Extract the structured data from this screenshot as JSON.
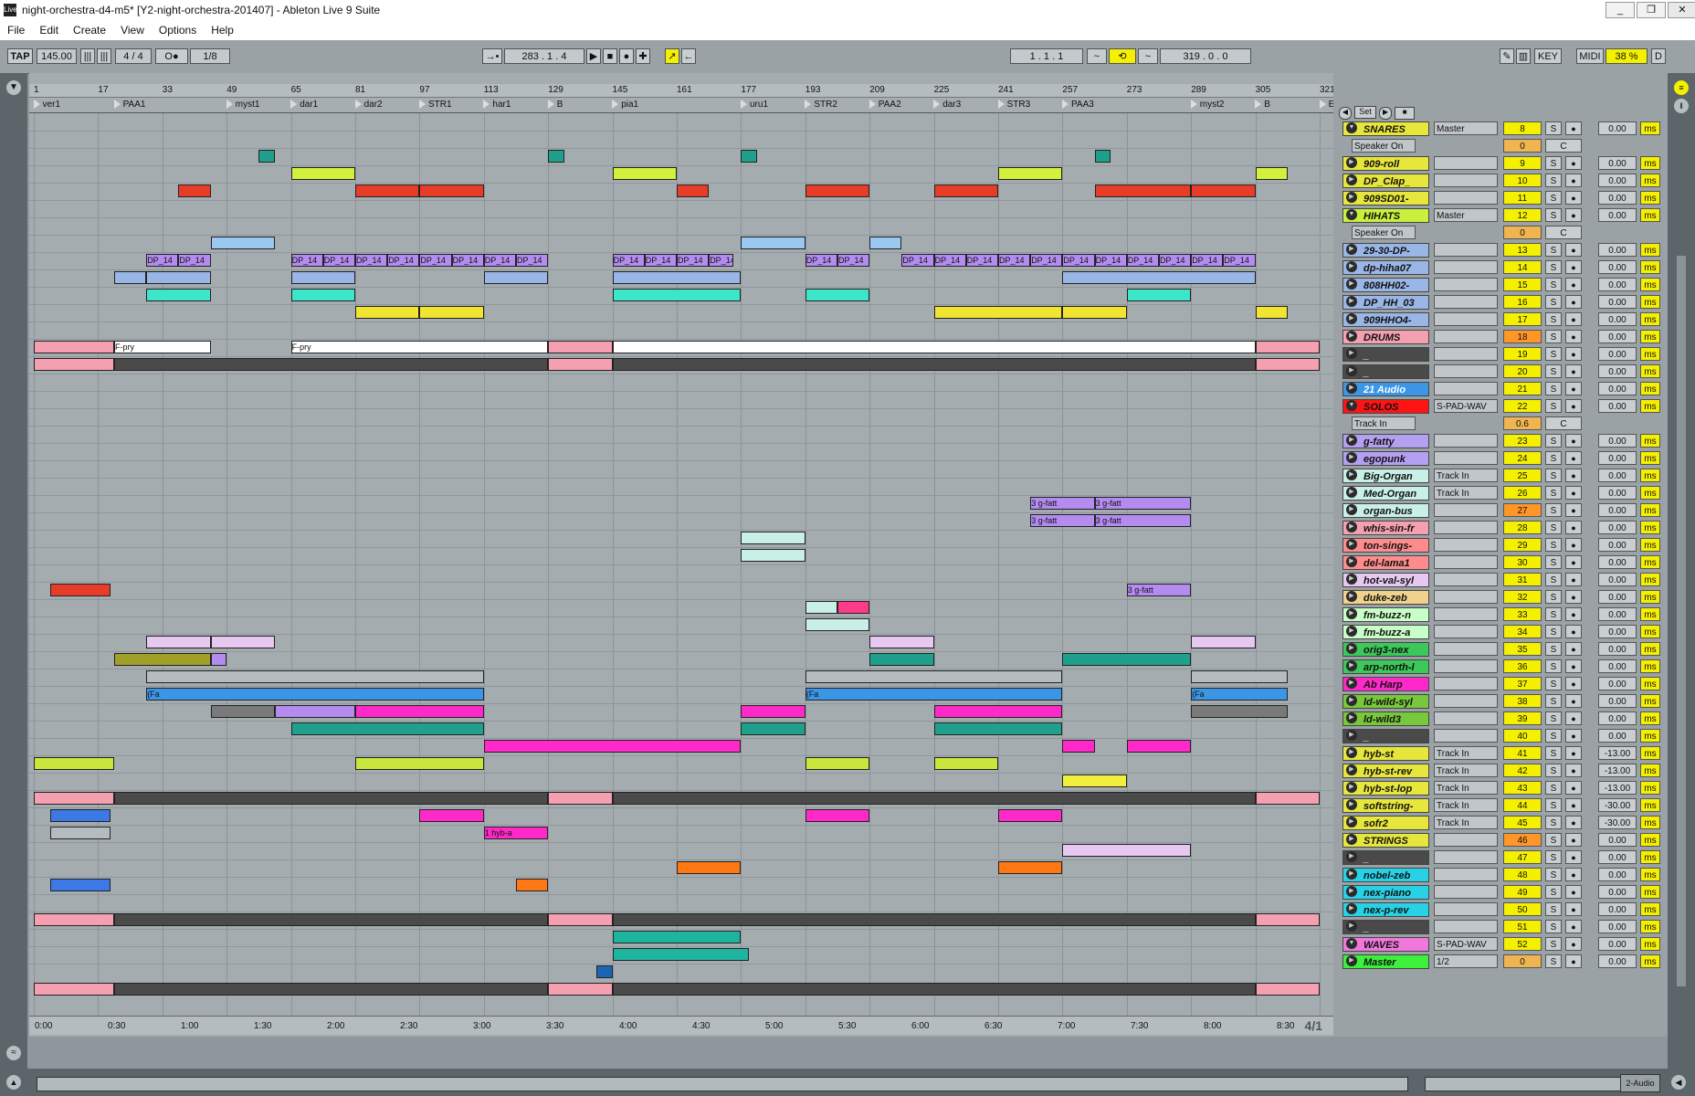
{
  "window": {
    "title": "night-orchestra-d4-m5*  [Y2-night-orchestra-201407] - Ableton Live 9 Suite",
    "logo_text": "Live",
    "controls": [
      "_",
      "❐",
      "✕"
    ]
  },
  "menu": [
    "File",
    "Edit",
    "Create",
    "View",
    "Options",
    "Help"
  ],
  "transport": {
    "tap": "TAP",
    "tempo": "145.00",
    "nudge": [
      "|||",
      "|||"
    ],
    "signature": "4 / 4",
    "metronome": "O●",
    "quantize": "1/8",
    "follow": "→•",
    "position": "283 .   1 .   4",
    "play": "▶",
    "stop": "■",
    "record": "●",
    "add": "✚",
    "draw": "↗",
    "back": "←",
    "loop_start": "1 .   1 .   1",
    "loop_length": "319 .   0 .   0",
    "pencil": "✎",
    "key": "KEY",
    "midi": "MIDI",
    "cpu": "38 %",
    "d": "D"
  },
  "ruler": [
    "1",
    "17",
    "33",
    "49",
    "65",
    "81",
    "97",
    "113",
    "129",
    "145",
    "161",
    "177",
    "193",
    "209",
    "225",
    "241",
    "257",
    "273",
    "289",
    "305",
    "321"
  ],
  "locators": [
    "ver1",
    "PAA1",
    "myst1",
    "dar1",
    "dar2",
    "STR1",
    "har1",
    "B",
    "pia1",
    "uru1",
    "STR2",
    "PAA2",
    "dar3",
    "STR3",
    "PAA3",
    "myst2",
    "B",
    "END"
  ],
  "time_ruler": [
    "0:00",
    "0:30",
    "1:00",
    "1:30",
    "2:00",
    "2:30",
    "3:00",
    "3:30",
    "4:00",
    "4:30",
    "5:00",
    "5:30",
    "6:00",
    "6:30",
    "7:00",
    "7:30",
    "8:00",
    "8:30"
  ],
  "time_sig_display": "4/1",
  "clip_labels": {
    "dp": "DP_14",
    "fpry": "F-pry",
    "f": "F",
    "gfatt": "3 g-fatt",
    "fa": "(Fa",
    "hyb": "1 hyb-a"
  },
  "mixer": {
    "top_buttons": [
      "◀",
      "Set",
      "▶",
      "■"
    ],
    "tracks": [
      {
        "name": "SNARES",
        "route": "Master",
        "num": "8",
        "delay": "0.00",
        "color": "#e6e63c",
        "group": true
      },
      {
        "name": "Speaker On",
        "route": "0",
        "num": "C",
        "delay": "",
        "color": "#e6e63c",
        "sub": true
      },
      {
        "name": "909-roll",
        "route": "",
        "num": "9",
        "delay": "0.00",
        "color": "#e6e63c"
      },
      {
        "name": "DP_Clap_",
        "route": "",
        "num": "10",
        "delay": "0.00",
        "color": "#e6e63c"
      },
      {
        "name": "909SD01-",
        "route": "",
        "num": "11",
        "delay": "0.00",
        "color": "#e6e63c"
      },
      {
        "name": "HIHATS",
        "route": "Master",
        "num": "12",
        "delay": "0.00",
        "color": "#c8f03c",
        "group": true
      },
      {
        "name": "Speaker On",
        "route": "0",
        "num": "C",
        "delay": "",
        "color": "#c8f03c",
        "sub": true
      },
      {
        "name": "29-30-DP-",
        "route": "",
        "num": "13",
        "delay": "0.00",
        "color": "#9ab6e6"
      },
      {
        "name": "dp-hiha07",
        "route": "",
        "num": "14",
        "delay": "0.00",
        "color": "#9ab6e6"
      },
      {
        "name": "808HH02-",
        "route": "",
        "num": "15",
        "delay": "0.00",
        "color": "#9ab6e6"
      },
      {
        "name": "DP_HH_03",
        "route": "",
        "num": "16",
        "delay": "0.00",
        "color": "#9ab6e6"
      },
      {
        "name": "909HHO4-",
        "route": "",
        "num": "17",
        "delay": "0.00",
        "color": "#9ab6e6"
      },
      {
        "name": "DRUMS",
        "route": "",
        "num": "18",
        "delay": "0.00",
        "color": "#f5a0b0"
      },
      {
        "name": "_",
        "route": "",
        "num": "19",
        "delay": "0.00",
        "color": "#4a4a4a"
      },
      {
        "name": "_",
        "route": "",
        "num": "20",
        "delay": "0.00",
        "color": "#4a4a4a"
      },
      {
        "name": "21 Audio",
        "route": "",
        "num": "21",
        "delay": "0.00",
        "color": "#3c96e6"
      },
      {
        "name": "SOLOS",
        "route": "S-PAD-WAV",
        "num": "22",
        "delay": "0.00",
        "color": "#ff1414",
        "group": true
      },
      {
        "name": "Track In",
        "route": "0.6",
        "num": "C",
        "delay": "",
        "color": "#ff1414",
        "sub": true
      },
      {
        "name": "g-fatty",
        "route": "",
        "num": "23",
        "delay": "0.00",
        "color": "#b4a0f0"
      },
      {
        "name": "egopunk",
        "route": "",
        "num": "24",
        "delay": "0.00",
        "color": "#b4a0f0"
      },
      {
        "name": "Big-Organ",
        "route": "Track In",
        "num": "25",
        "delay": "0.00",
        "color": "#c8f0e6"
      },
      {
        "name": "Med-Organ",
        "route": "Track In",
        "num": "26",
        "delay": "0.00",
        "color": "#c8f0e6"
      },
      {
        "name": "organ-bus",
        "route": "",
        "num": "27",
        "delay": "0.00",
        "color": "#c8f0e6"
      },
      {
        "name": "whis-sin-fr",
        "route": "",
        "num": "28",
        "delay": "0.00",
        "color": "#f5a0b0"
      },
      {
        "name": "ton-sings-",
        "route": "",
        "num": "29",
        "delay": "0.00",
        "color": "#ff8c8c"
      },
      {
        "name": "del-lama1",
        "route": "",
        "num": "30",
        "delay": "0.00",
        "color": "#ff8c8c"
      },
      {
        "name": "hot-val-syl",
        "route": "",
        "num": "31",
        "delay": "0.00",
        "color": "#e6c8f0"
      },
      {
        "name": "duke-zeb",
        "route": "",
        "num": "32",
        "delay": "0.00",
        "color": "#f0d28c"
      },
      {
        "name": "fm-buzz-n",
        "route": "",
        "num": "33",
        "delay": "0.00",
        "color": "#c8ffc8"
      },
      {
        "name": "fm-buzz-a",
        "route": "",
        "num": "34",
        "delay": "0.00",
        "color": "#c8ffc8"
      },
      {
        "name": "orig3-nex",
        "route": "",
        "num": "35",
        "delay": "0.00",
        "color": "#3cc85a"
      },
      {
        "name": "arp-north-l",
        "route": "",
        "num": "36",
        "delay": "0.00",
        "color": "#3cc85a"
      },
      {
        "name": "Ab Harp",
        "route": "",
        "num": "37",
        "delay": "0.00",
        "color": "#ff28c8"
      },
      {
        "name": "ld-wild-syl",
        "route": "",
        "num": "38",
        "delay": "0.00",
        "color": "#78c83c"
      },
      {
        "name": "ld-wild3",
        "route": "",
        "num": "39",
        "delay": "0.00",
        "color": "#78c83c"
      },
      {
        "name": "_",
        "route": "",
        "num": "40",
        "delay": "0.00",
        "color": "#4a4a4a"
      },
      {
        "name": "hyb-st",
        "route": "Track In",
        "num": "41",
        "delay": "-13.00",
        "color": "#e6e63c"
      },
      {
        "name": "hyb-st-rev",
        "route": "Track In",
        "num": "42",
        "delay": "-13.00",
        "color": "#e6e63c"
      },
      {
        "name": "hyb-st-lop",
        "route": "Track In",
        "num": "43",
        "delay": "-13.00",
        "color": "#e6e63c"
      },
      {
        "name": "softstring-",
        "route": "Track In",
        "num": "44",
        "delay": "-30.00",
        "color": "#e6e63c"
      },
      {
        "name": "sofr2",
        "route": "Track In",
        "num": "45",
        "delay": "-30.00",
        "color": "#e6e63c"
      },
      {
        "name": "STRINGS",
        "route": "",
        "num": "46",
        "delay": "0.00",
        "color": "#e6e63c"
      },
      {
        "name": "_",
        "route": "",
        "num": "47",
        "delay": "0.00",
        "color": "#4a4a4a"
      },
      {
        "name": "nobel-zeb",
        "route": "",
        "num": "48",
        "delay": "0.00",
        "color": "#28d2e6"
      },
      {
        "name": "nex-piano",
        "route": "",
        "num": "49",
        "delay": "0.00",
        "color": "#28d2e6"
      },
      {
        "name": "nex-p-rev",
        "route": "",
        "num": "50",
        "delay": "0.00",
        "color": "#28d2e6"
      },
      {
        "name": "_",
        "route": "",
        "num": "51",
        "delay": "0.00",
        "color": "#4a4a4a"
      },
      {
        "name": "WAVES",
        "route": "S-PAD-WAV",
        "num": "52",
        "delay": "0.00",
        "color": "#f078dc",
        "group": true
      },
      {
        "name": "Master",
        "route": "1/2",
        "num": "0",
        "delay": "0.00",
        "color": "#3cf03c",
        "master": true
      }
    ],
    "solo": "S",
    "ms_label": "ms"
  },
  "status_bar": {
    "device_label": "2-Audio"
  }
}
